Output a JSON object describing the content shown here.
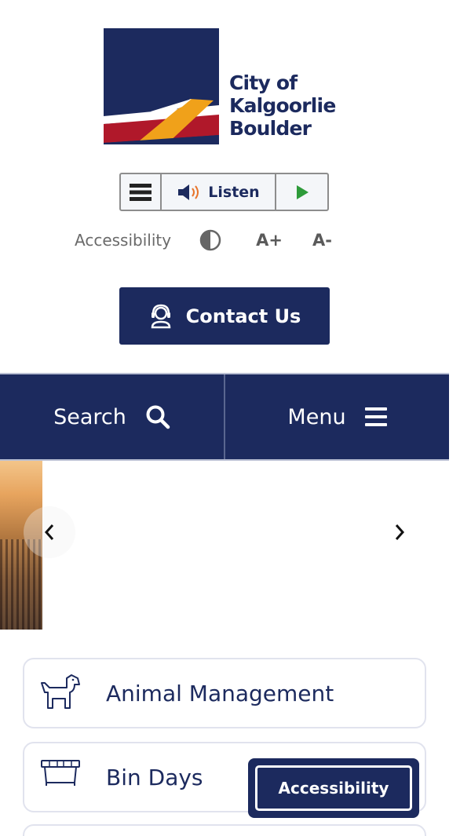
{
  "logo": {
    "line1": "City of",
    "line2": "Kalgoorlie",
    "line3": "Boulder",
    "colors": {
      "navy": "#1c2a5e",
      "red": "#b0182a",
      "orange": "#f0a11a"
    }
  },
  "listen_bar": {
    "menu_icon": "hamburger-icon",
    "speaker_icon": "speaker-icon",
    "listen_label": "Listen",
    "play_icon": "play-icon",
    "play_color": "#2e9b3a"
  },
  "accessibility": {
    "label": "Accessibility",
    "contrast_icon": "contrast-icon",
    "increase_label": "A+",
    "decrease_label": "A-"
  },
  "contact": {
    "icon": "headset-icon",
    "label": "Contact Us"
  },
  "nav": {
    "search_label": "Search",
    "search_icon": "search-icon",
    "menu_label": "Menu",
    "menu_icon": "hamburger-icon"
  },
  "carousel": {
    "prev_icon": "chevron-left-icon",
    "next_icon": "chevron-right-icon"
  },
  "quick_links": [
    {
      "label": "Animal Management",
      "icon": "dog-icon"
    },
    {
      "label": "Bin Days",
      "icon": "bin-icon"
    }
  ],
  "floating_button": {
    "label": "Accessibility"
  },
  "theme": {
    "primary": "#1c2a5e",
    "border": "#e1e3ee"
  }
}
